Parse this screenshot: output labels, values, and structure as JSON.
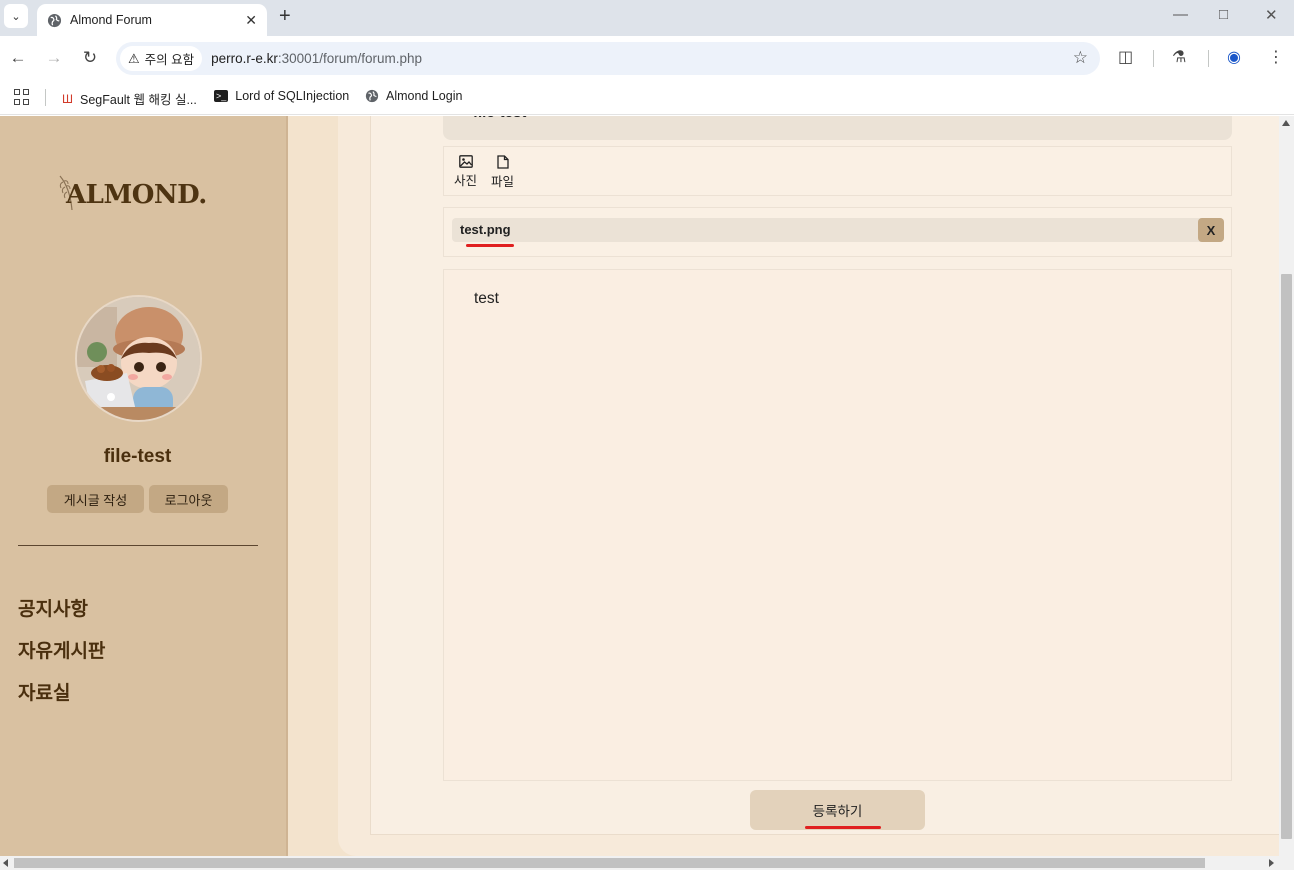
{
  "browser": {
    "tab_title": "Almond Forum",
    "new_tab_symbol": "+",
    "omnibox": {
      "security_label": "주의 요함",
      "url_host": "perro.r-e.kr",
      "url_rest": ":30001/forum/forum.php"
    },
    "bookmarks": [
      {
        "label": "SegFault 웹 해킹 실...",
        "icon": "segfault-icon"
      },
      {
        "label": "Lord of SQLInjection",
        "icon": "terminal-icon"
      },
      {
        "label": "Almond Login",
        "icon": "globe-icon"
      }
    ],
    "colors": {
      "tabbar": "#dee3ea",
      "omnibox": "#edf2fa"
    }
  },
  "sidebar": {
    "logo_text": "ALMOND.",
    "username": "file-test",
    "buttons": {
      "write": "게시글 작성",
      "logout": "로그아웃"
    },
    "menu": [
      {
        "label": "공지사항"
      },
      {
        "label": "자유게시판"
      },
      {
        "label": "자료실"
      }
    ],
    "colors": {
      "background": "#d9c1a1",
      "text": "#4a2f0e",
      "button": "#c3a884"
    }
  },
  "editor": {
    "title": "file-test",
    "attach_buttons": {
      "photo": "사진",
      "file": "파일"
    },
    "attached_file": {
      "name": "test.png",
      "remove_label": "X"
    },
    "body_text": "test",
    "submit_label": "등록하기",
    "colors": {
      "highlight_underline": "#e02020",
      "submit": "#e3d2bb"
    }
  }
}
